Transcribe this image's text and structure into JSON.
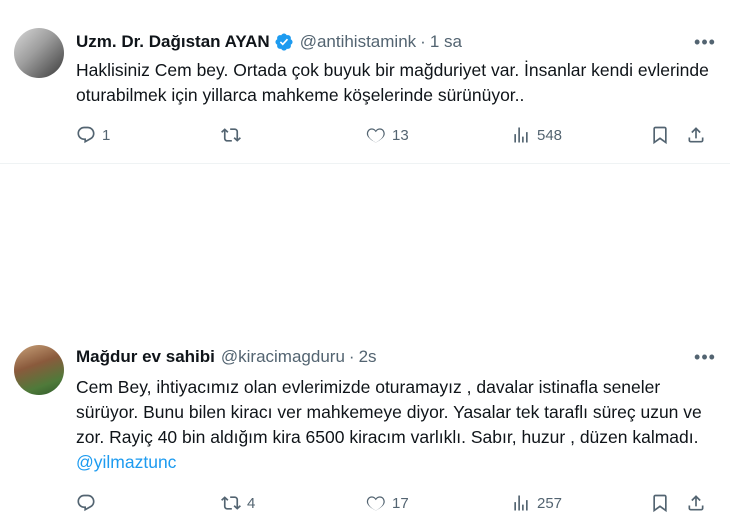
{
  "tweets": [
    {
      "display_name": "Uzm. Dr. Dağıstan AYAN",
      "handle": "@antihistamink",
      "separator": "·",
      "time": "1 sa",
      "verified": true,
      "text": "Haklisiniz Cem bey. Ortada çok buyuk bir mağduriyet var. İnsanlar kendi evlerinde oturabilmek için yillarca mahkeme köşelerinde sürünüyor..",
      "mention": "",
      "replies": "1",
      "retweets": "",
      "likes": "13",
      "views": "548",
      "more_icon": "more-horizontal-icon"
    },
    {
      "display_name": "Mağdur ev sahibi",
      "handle": "@kiracimagduru",
      "separator": "·",
      "time": "2s",
      "verified": false,
      "text": "Cem Bey, ihtiyacımız olan evlerimizde oturamayız , davalar istinafla seneler sürüyor. Bunu bilen kiracı ver mahkemeye diyor. Yasalar tek taraflı süreç uzun ve zor. Rayiç 40 bin aldığım kira 6500 kiracım varlıklı. Sabır, huzur , düzen kalmadı.",
      "mention": "@yilmaztunc",
      "replies": "",
      "retweets": "4",
      "likes": "17",
      "views": "257",
      "more_icon": "more-horizontal-icon"
    }
  ],
  "colors": {
    "text": "#0f1419",
    "secondary": "#536471",
    "accent": "#1d9bf0",
    "divider": "#eff3f4"
  }
}
